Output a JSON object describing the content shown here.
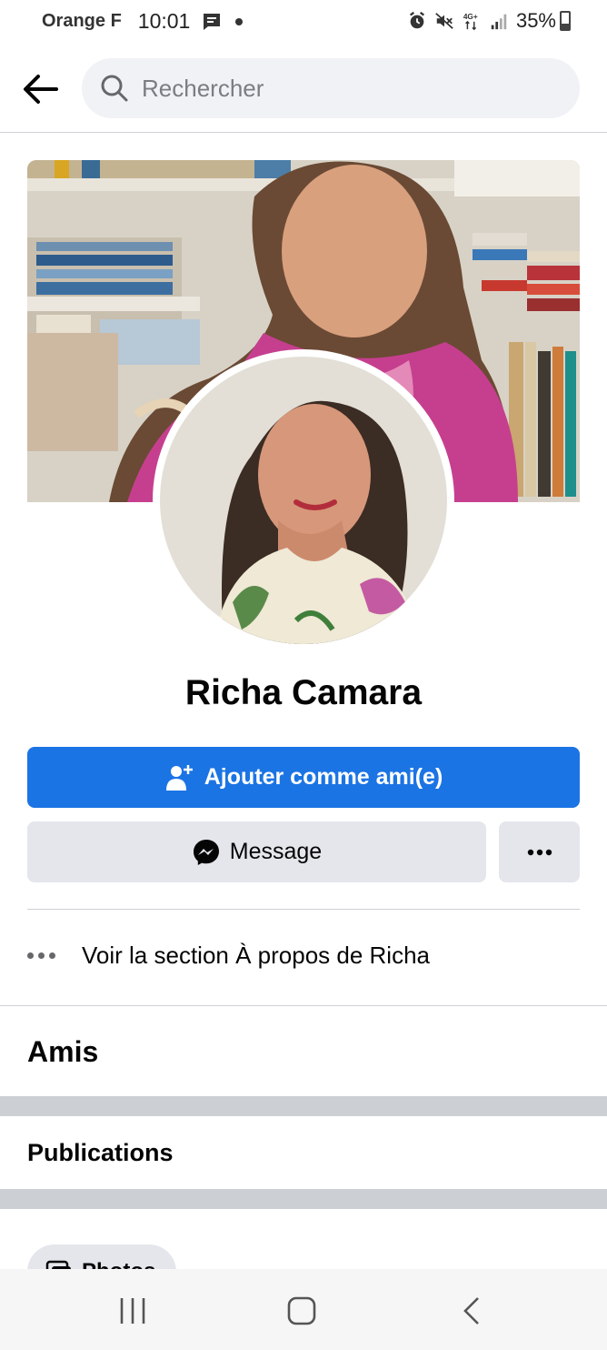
{
  "status_bar": {
    "carrier": "Orange F",
    "time": "10:01",
    "network": "4G+",
    "battery": "35%",
    "battery_level": 0.35
  },
  "search": {
    "placeholder": "Rechercher"
  },
  "profile": {
    "name": "Richa Camara"
  },
  "actions": {
    "add_friend": "Ajouter comme ami(e)",
    "message": "Message"
  },
  "about_link": "Voir la section À propos de Richa",
  "sections": {
    "friends": "Amis",
    "posts": "Publications",
    "photos": "Photos"
  },
  "colors": {
    "primary": "#1b74e4",
    "secondary_button": "#e4e6eb",
    "search_bg": "#f0f2f5",
    "separator_band": "#ccd0d5"
  },
  "icons": {
    "back": "arrow-left-icon",
    "search": "search-icon",
    "add_friend": "person-plus-icon",
    "message": "messenger-icon",
    "more": "more-dots-icon",
    "about": "dots-icon",
    "photos": "photos-icon",
    "nav_recents": "recents-icon",
    "nav_home": "home-icon",
    "nav_back": "back-chevron-icon"
  }
}
